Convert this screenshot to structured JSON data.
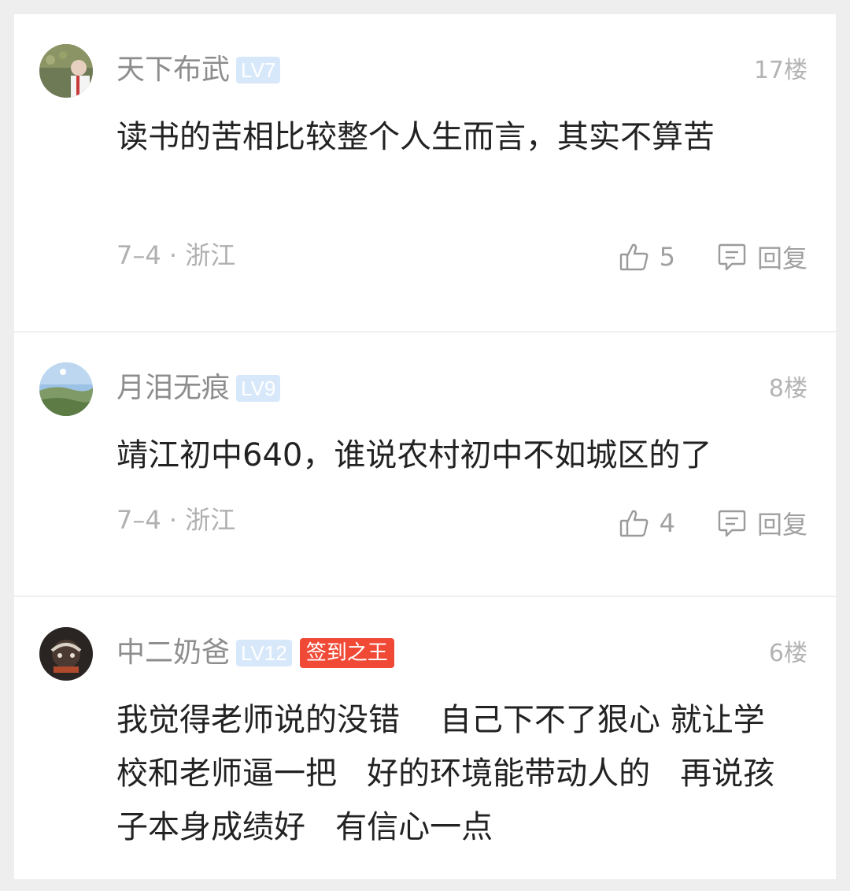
{
  "comments": [
    {
      "username": "天下布武",
      "level": "LV7",
      "floor": "17楼",
      "content": "读书的苦相比较整个人生而言，其实不算苦",
      "meta": "7–4 · 浙江",
      "likes": "5",
      "reply": "回复"
    },
    {
      "username": "月泪无痕",
      "level": "LV9",
      "floor": "8楼",
      "content": "靖江初中640，谁说农村初中不如城区的了",
      "meta": "7–4 · 浙江",
      "likes": "4",
      "reply": "回复"
    },
    {
      "username": "中二奶爸",
      "level": "LV12",
      "badge": "签到之王",
      "floor": "6楼",
      "content": "我觉得老师说的没错    自己下不了狠心 就让学校和老师逼一把   好的环境能带动人的   再说孩子本身成绩好   有信心一点"
    }
  ],
  "colors": {
    "background": "#eeeeee",
    "card": "#ffffff",
    "level_badge": "#d8e8fb",
    "badge_red": "#f04a37"
  },
  "icons": {
    "like": "thumbs-up-icon",
    "reply": "comment-bubble-icon"
  }
}
